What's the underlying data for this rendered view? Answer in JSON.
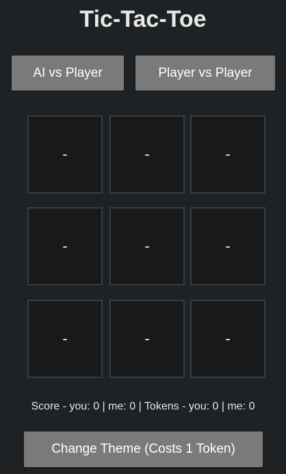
{
  "title": "Tic-Tac-Toe",
  "modes": {
    "ai_vs_player": "AI vs Player",
    "player_vs_player": "Player vs Player"
  },
  "board": {
    "cells": [
      "-",
      "-",
      "-",
      "-",
      "-",
      "-",
      "-",
      "-",
      "-"
    ]
  },
  "status": {
    "score_line": "Score - you: 0 | me: 0 | Tokens - you: 0 | me: 0",
    "score_you": 0,
    "score_me": 0,
    "tokens_you": 0,
    "tokens_me": 0
  },
  "theme_button": "Change Theme (Costs 1 Token)",
  "colors": {
    "background": "#1f2224",
    "button": "#7a7a7a",
    "cell": "#18191a",
    "cell_border": "#3a3d3f"
  }
}
